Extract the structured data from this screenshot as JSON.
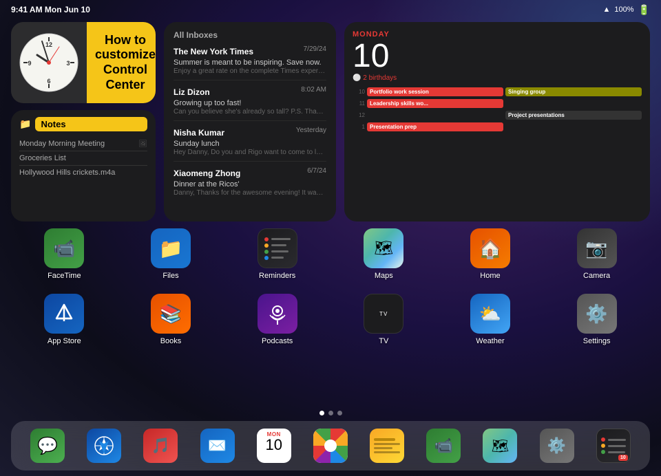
{
  "statusBar": {
    "time": "9:41 AM  Mon Jun 10",
    "battery": "100%",
    "wifiLabel": "WiFi"
  },
  "widgets": {
    "clock": {
      "label": "Clock"
    },
    "controlCenterTip": {
      "text": "How to customize Control Center"
    },
    "notes": {
      "title": "Notes",
      "items": [
        {
          "text": "Monday Morning Meeting",
          "hasThumb": true
        },
        {
          "text": "Groceries List",
          "hasThumb": false
        },
        {
          "text": "Hollywood Hills crickets.m4a",
          "hasThumb": false
        }
      ]
    },
    "mail": {
      "header": "All Inboxes",
      "emails": [
        {
          "sender": "The New York Times",
          "date": "7/29/24",
          "subject": "Summer is meant to be inspiring. Save now.",
          "preview": "Enjoy a great rate on the complete Times experie..."
        },
        {
          "sender": "Liz Dizon",
          "date": "8:02 AM",
          "subject": "Growing up too fast!",
          "preview": "Can you believe she's already so tall? P.S. Thanks..."
        },
        {
          "sender": "Nisha Kumar",
          "date": "Yesterday",
          "subject": "Sunday lunch",
          "preview": "Hey Danny, Do you and Rigo want to come to lun..."
        },
        {
          "sender": "Xiaomeng Zhong",
          "date": "6/7/24",
          "subject": "Dinner at the Ricos'",
          "preview": "Danny, Thanks for the awesome evening! It was s..."
        }
      ]
    },
    "calendar": {
      "dayLabel": "MONDAY",
      "date": "10",
      "birthdays": "2 birthdays",
      "events": [
        {
          "label": "Portfolio work session",
          "color": "red",
          "time": "10"
        },
        {
          "label": "Singing group",
          "color": "olive",
          "time": ""
        },
        {
          "label": "Leadership skills wo...",
          "color": "red",
          "time": "11"
        },
        {
          "label": "",
          "color": "",
          "time": ""
        },
        {
          "label": "Presentation prep",
          "color": "red",
          "time": "1"
        },
        {
          "label": "Project presentations",
          "color": "dark",
          "time": ""
        }
      ]
    }
  },
  "appGrid": {
    "row1": [
      {
        "label": "FaceTime",
        "icon": "facetime"
      },
      {
        "label": "Files",
        "icon": "files"
      },
      {
        "label": "Reminders",
        "icon": "reminders"
      },
      {
        "label": "Maps",
        "icon": "maps"
      },
      {
        "label": "Home",
        "icon": "home"
      },
      {
        "label": "Camera",
        "icon": "camera"
      }
    ],
    "row2": [
      {
        "label": "App Store",
        "icon": "appstore"
      },
      {
        "label": "Books",
        "icon": "books"
      },
      {
        "label": "Podcasts",
        "icon": "podcasts"
      },
      {
        "label": "TV",
        "icon": "tv"
      },
      {
        "label": "Weather",
        "icon": "weather"
      },
      {
        "label": "Settings",
        "icon": "settings"
      }
    ]
  },
  "pageDots": {
    "total": 3,
    "active": 0
  },
  "dock": {
    "apps": [
      {
        "label": "Messages",
        "icon": "messages"
      },
      {
        "label": "Safari",
        "icon": "safari"
      },
      {
        "label": "Music",
        "icon": "music"
      },
      {
        "label": "Mail",
        "icon": "mail"
      },
      {
        "label": "Calendar",
        "icon": "calendar-d"
      },
      {
        "label": "Photos",
        "icon": "photos"
      },
      {
        "label": "Notes",
        "icon": "notes-d"
      },
      {
        "label": "FaceTime",
        "icon": "facetime-d"
      },
      {
        "label": "Maps",
        "icon": "maps-d"
      },
      {
        "label": "Settings",
        "icon": "settings-d"
      },
      {
        "label": "Reminders",
        "icon": "reminders-d"
      }
    ],
    "calDockDay": "MON",
    "calDockNum": "10"
  }
}
